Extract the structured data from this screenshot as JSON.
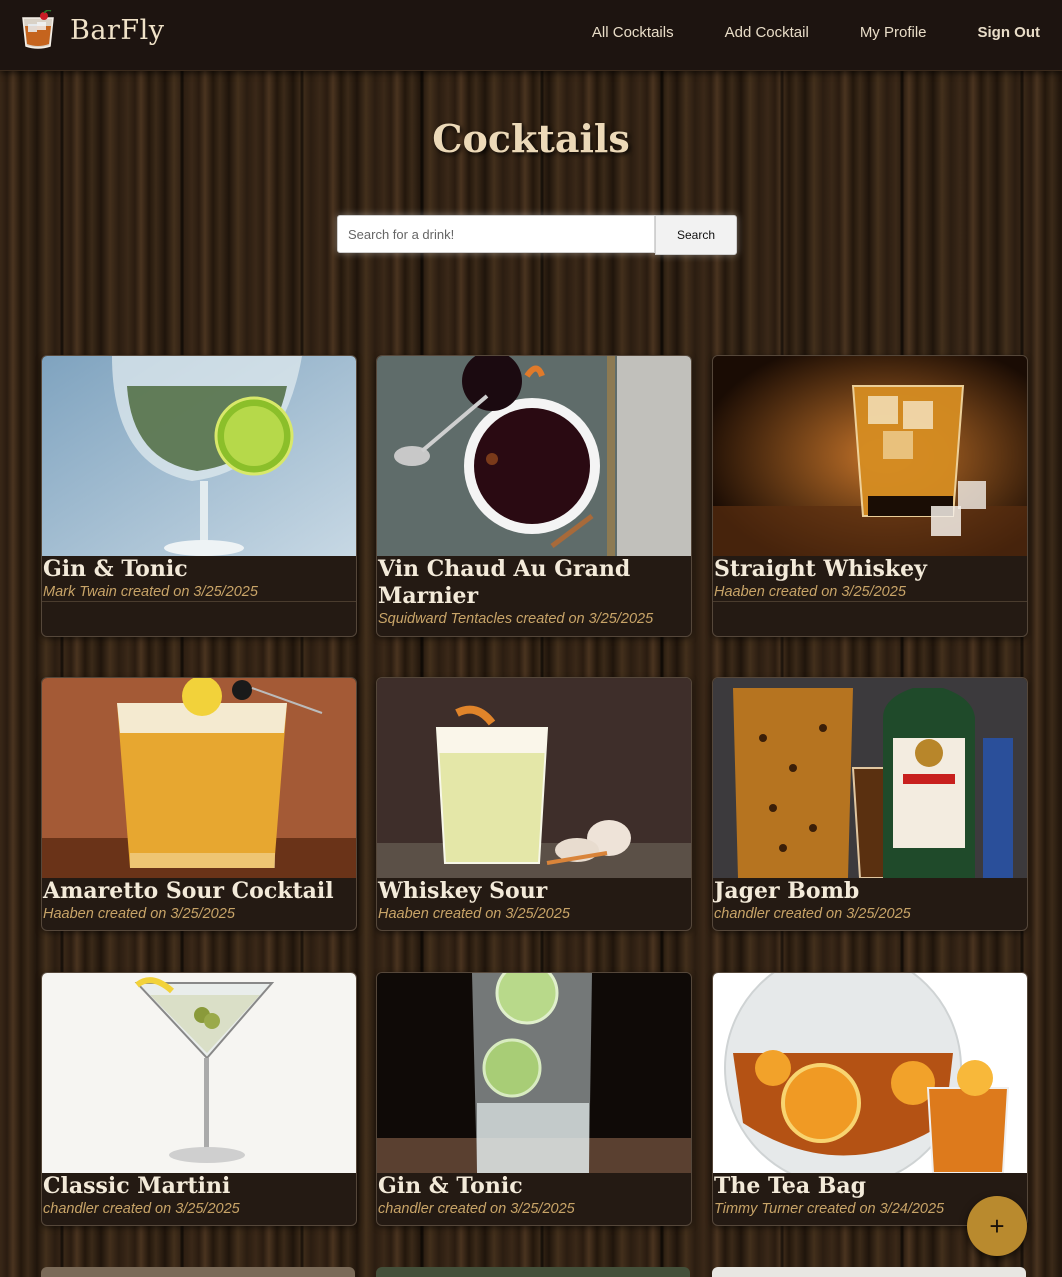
{
  "nav": {
    "brand": "BarFly",
    "links": [
      "All Cocktails",
      "Add Cocktail",
      "My Profile",
      "Sign Out"
    ]
  },
  "page": {
    "title": "Cocktails"
  },
  "search": {
    "placeholder": "Search for a drink!",
    "button_label": "Search"
  },
  "cocktails": [
    {
      "name": "Gin & Tonic",
      "meta": "Mark Twain created on 3/25/2025"
    },
    {
      "name": "Vin Chaud Au Grand Marnier",
      "meta": "Squidward Tentacles created on 3/25/2025"
    },
    {
      "name": "Straight Whiskey",
      "meta": "Haaben created on 3/25/2025"
    },
    {
      "name": "Amaretto Sour Cocktail",
      "meta": "Haaben created on 3/25/2025"
    },
    {
      "name": "Whiskey Sour",
      "meta": "Haaben created on 3/25/2025"
    },
    {
      "name": "Jager Bomb",
      "meta": "chandler created on 3/25/2025"
    },
    {
      "name": "Classic Martini",
      "meta": "chandler created on 3/25/2025"
    },
    {
      "name": "Gin & Tonic",
      "meta": "chandler created on 3/25/2025"
    },
    {
      "name": "The Tea Bag",
      "meta": "Timmy Turner created on 3/24/2025"
    }
  ],
  "fab": {
    "label": "+"
  },
  "colors": {
    "nav_bg": "#1d1410",
    "accent": "#b98a2e",
    "meta_text": "#c8a468"
  }
}
